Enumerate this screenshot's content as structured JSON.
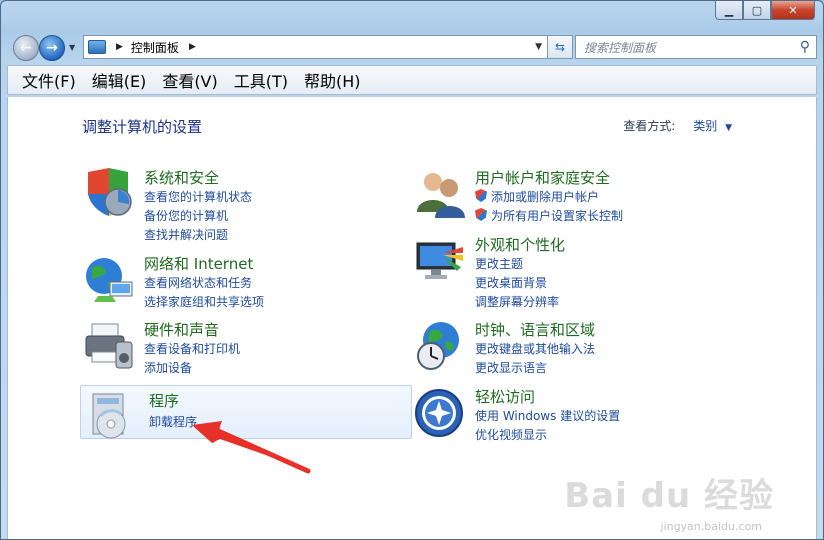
{
  "address": {
    "location": "控制面板"
  },
  "search": {
    "placeholder": "搜索控制面板"
  },
  "menu": [
    "文件(F)",
    "编辑(E)",
    "查看(V)",
    "工具(T)",
    "帮助(H)"
  ],
  "page": {
    "title": "调整计算机的设置",
    "view_by_label": "查看方式:",
    "view_by_value": "类别"
  },
  "categories": {
    "system": {
      "title": "系统和安全",
      "links": [
        "查看您的计算机状态",
        "备份您的计算机",
        "查找并解决问题"
      ]
    },
    "network": {
      "title": "网络和 Internet",
      "links": [
        "查看网络状态和任务",
        "选择家庭组和共享选项"
      ]
    },
    "hardware": {
      "title": "硬件和声音",
      "links": [
        "查看设备和打印机",
        "添加设备"
      ]
    },
    "programs": {
      "title": "程序",
      "links": [
        "卸载程序"
      ]
    },
    "users": {
      "title": "用户帐户和家庭安全",
      "links": [
        "添加或删除用户帐户",
        "为所有用户设置家长控制"
      ]
    },
    "appearance": {
      "title": "外观和个性化",
      "links": [
        "更改主题",
        "更改桌面背景",
        "调整屏幕分辨率"
      ]
    },
    "clock": {
      "title": "时钟、语言和区域",
      "links": [
        "更改键盘或其他输入法",
        "更改显示语言"
      ]
    },
    "ease": {
      "title": "轻松访问",
      "links": [
        "使用 Windows 建议的设置",
        "优化视频显示"
      ]
    }
  },
  "watermark": {
    "brand": "Bai du 经验",
    "url": "jingyan.baidu.com"
  },
  "colors": {
    "heading_green": "#1e6b20",
    "link_blue": "#1e4a9c",
    "arrow_red": "#e8302a"
  }
}
